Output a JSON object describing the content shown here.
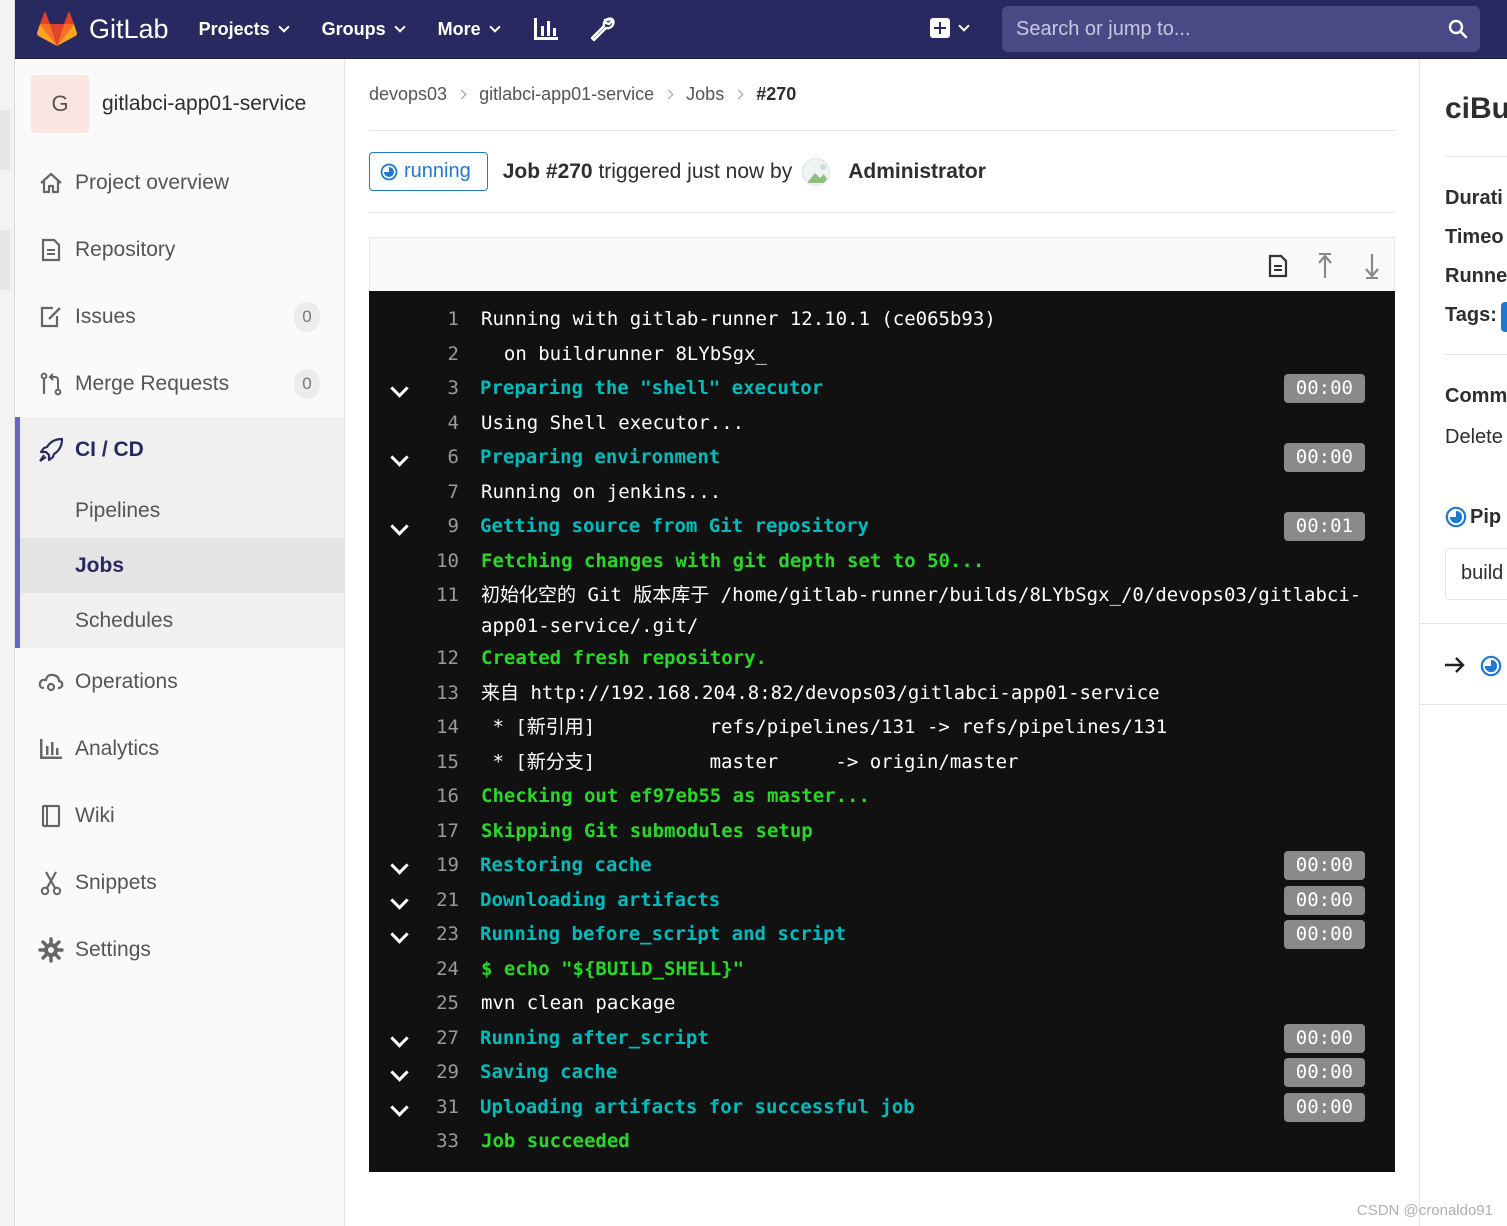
{
  "navbar": {
    "brand": "GitLab",
    "menu": [
      {
        "label": "Projects"
      },
      {
        "label": "Groups"
      },
      {
        "label": "More"
      }
    ],
    "search_placeholder": "Search or jump to...",
    "colors": {
      "bg": "#292961",
      "search_bg": "#494986"
    }
  },
  "sidebar": {
    "project_initial": "G",
    "project_name": "gitlabci-app01-service",
    "items_top": [
      {
        "label": "Project overview",
        "icon": "home-icon"
      },
      {
        "label": "Repository",
        "icon": "document-icon"
      },
      {
        "label": "Issues",
        "icon": "issues-icon",
        "count": "0"
      },
      {
        "label": "Merge Requests",
        "icon": "merge-request-icon",
        "count": "0"
      }
    ],
    "cicd": {
      "label": "CI / CD",
      "icon": "rocket-icon",
      "sub_items": [
        {
          "label": "Pipelines",
          "active": false
        },
        {
          "label": "Jobs",
          "active": true
        },
        {
          "label": "Schedules",
          "active": false
        }
      ]
    },
    "items_bottom": [
      {
        "label": "Operations",
        "icon": "cloud-gear-icon"
      },
      {
        "label": "Analytics",
        "icon": "chart-icon"
      },
      {
        "label": "Wiki",
        "icon": "book-icon"
      },
      {
        "label": "Snippets",
        "icon": "scissors-icon"
      },
      {
        "label": "Settings",
        "icon": "gear-icon"
      }
    ]
  },
  "breadcrumb": [
    "devops03",
    "gitlabci-app01-service",
    "Jobs",
    "#270"
  ],
  "job": {
    "status": "running",
    "title_bold": "Job #270",
    "title_rest": " triggered just now by",
    "user": "Administrator"
  },
  "log": [
    {
      "num": "1",
      "text": "Running with gitlab-runner 12.10.1 (ce065b93)",
      "kind": "plain"
    },
    {
      "num": "2",
      "text": "  on buildrunner 8LYbSgx_",
      "kind": "plain"
    },
    {
      "num": "3",
      "text": "Preparing the \"shell\" executor",
      "kind": "section",
      "duration": "00:00"
    },
    {
      "num": "4",
      "text": "Using Shell executor...",
      "kind": "plain"
    },
    {
      "num": "6",
      "text": "Preparing environment",
      "kind": "section",
      "duration": "00:00"
    },
    {
      "num": "7",
      "text": "Running on jenkins...",
      "kind": "plain"
    },
    {
      "num": "9",
      "text": "Getting source from Git repository",
      "kind": "section",
      "duration": "00:01"
    },
    {
      "num": "10",
      "text": "Fetching changes with git depth set to 50...",
      "kind": "green"
    },
    {
      "num": "11",
      "text": "初始化空的 Git 版本库于 /home/gitlab-runner/builds/8LYbSgx_/0/devops03/gitlabci-app01-service/.git/",
      "kind": "plain"
    },
    {
      "num": "12",
      "text": "Created fresh repository.",
      "kind": "green"
    },
    {
      "num": "13",
      "text": "来自 http://192.168.204.8:82/devops03/gitlabci-app01-service",
      "kind": "plain"
    },
    {
      "num": "14",
      "text": " * [新引用]          refs/pipelines/131 -> refs/pipelines/131",
      "kind": "plain"
    },
    {
      "num": "15",
      "text": " * [新分支]          master     -> origin/master",
      "kind": "plain"
    },
    {
      "num": "16",
      "text": "Checking out ef97eb55 as master...",
      "kind": "green"
    },
    {
      "num": "17",
      "text": "Skipping Git submodules setup",
      "kind": "green"
    },
    {
      "num": "19",
      "text": "Restoring cache",
      "kind": "section",
      "duration": "00:00"
    },
    {
      "num": "21",
      "text": "Downloading artifacts",
      "kind": "section",
      "duration": "00:00"
    },
    {
      "num": "23",
      "text": "Running before_script and script",
      "kind": "section",
      "duration": "00:00"
    },
    {
      "num": "24",
      "text": "$ echo \"${BUILD_SHELL}\"",
      "kind": "green"
    },
    {
      "num": "25",
      "text": "mvn clean package",
      "kind": "plain"
    },
    {
      "num": "27",
      "text": "Running after_script",
      "kind": "section",
      "duration": "00:00"
    },
    {
      "num": "29",
      "text": "Saving cache",
      "kind": "section",
      "duration": "00:00"
    },
    {
      "num": "31",
      "text": "Uploading artifacts for successful job",
      "kind": "section",
      "duration": "00:00"
    },
    {
      "num": "33",
      "text": "Job succeeded",
      "kind": "green"
    }
  ],
  "right_panel": {
    "title": "ciBui",
    "labels": [
      "Durati",
      "Timeo",
      "Runne",
      "Tags:"
    ],
    "commit_label": "Comm",
    "commit_text": "Delete",
    "pipeline_label": "Pip",
    "stage_select": "build"
  },
  "watermark": "CSDN @cronaldo91"
}
